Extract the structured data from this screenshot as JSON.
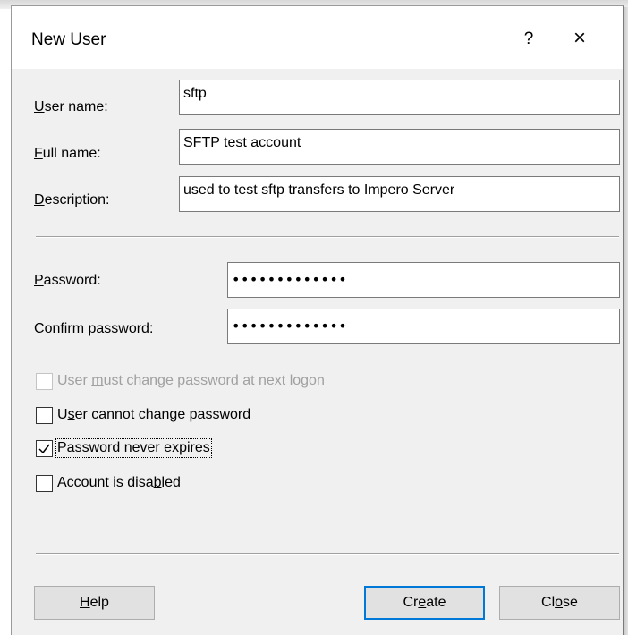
{
  "window": {
    "title": "New User",
    "help_label": "?",
    "close_label": "×"
  },
  "form": {
    "user_name": {
      "label_pre": "",
      "label_accel": "U",
      "label_post": "ser name:",
      "value": "sftp"
    },
    "full_name": {
      "label_pre": "",
      "label_accel": "F",
      "label_post": "ull name:",
      "value": "SFTP test account"
    },
    "description": {
      "label_pre": "",
      "label_accel": "D",
      "label_post": "escription:",
      "value": "used to test sftp transfers to Impero Server"
    },
    "password": {
      "label_pre": "",
      "label_accel": "P",
      "label_post": "assword:",
      "value": "•••••••••••••"
    },
    "confirm_password": {
      "label_pre": "",
      "label_accel": "C",
      "label_post": "onfirm password:",
      "value": "•••••••••••••"
    }
  },
  "options": {
    "must_change": {
      "label_pre": "User ",
      "label_accel": "m",
      "label_post": "ust change password at next logon",
      "checked": false,
      "disabled": true
    },
    "cannot_change": {
      "label_pre": "U",
      "label_accel": "s",
      "label_post": "er cannot change password",
      "checked": false,
      "disabled": false
    },
    "never_expires": {
      "label_pre": "Pass",
      "label_accel": "w",
      "label_post": "ord never expires",
      "checked": true,
      "disabled": false
    },
    "disabled": {
      "label_pre": "Account is disa",
      "label_accel": "b",
      "label_post": "led",
      "checked": false,
      "disabled": false
    }
  },
  "buttons": {
    "help": {
      "pre": "",
      "accel": "H",
      "post": "elp"
    },
    "create": {
      "pre": "Cr",
      "accel": "e",
      "post": "ate"
    },
    "close": {
      "pre": "Cl",
      "accel": "o",
      "post": "se"
    }
  }
}
